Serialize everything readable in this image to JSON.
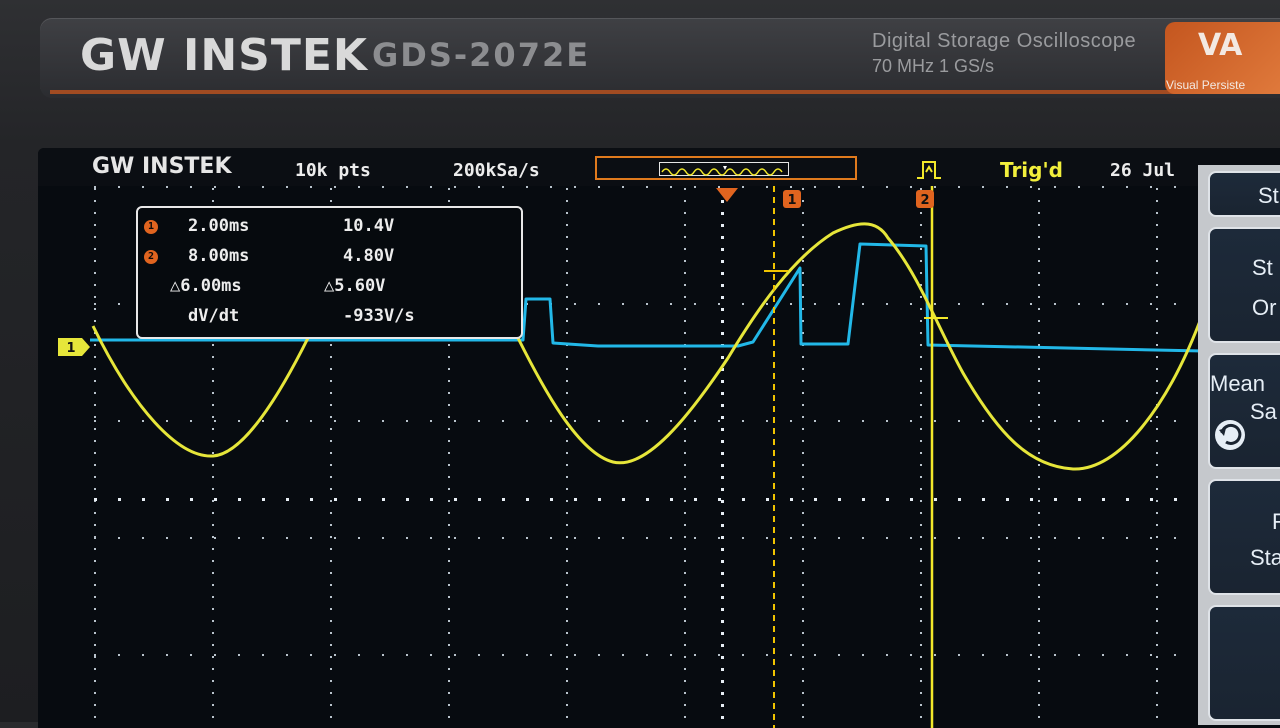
{
  "brand": {
    "logo": "GW INSTEK",
    "model": "GDS-2072E",
    "description_line1": "Digital  Storage  Oscilloscope",
    "description_line2": "70 MHz   1 GS/s",
    "va_logo": "VA",
    "va_subtitle": "Visual Persiste"
  },
  "status_bar": {
    "logo": "GW INSTEK",
    "record_length": "10k pts",
    "sample_rate": "200kSa/s",
    "trigger_status": "Trig'd",
    "date": "26 Jul"
  },
  "markers": {
    "channel1": "1",
    "cursor1": "1",
    "cursor2": "2"
  },
  "cursor_readout": {
    "cursor1": {
      "badge": "1",
      "time": "2.00ms",
      "voltage": "10.4V"
    },
    "cursor2": {
      "badge": "2",
      "time": "8.00ms",
      "voltage": "4.80V"
    },
    "delta": {
      "time": "△6.00ms",
      "voltage": "△5.60V"
    },
    "slope": {
      "label": "dV/dt",
      "value": "-933V/s"
    }
  },
  "side_menu": {
    "key1": "St",
    "key2_line1": "St",
    "key2_line2": "Or",
    "key3_line1": "Mean",
    "key3_line2": "Sa",
    "key4_line1": "F",
    "key4_line2": "Sta",
    "key5": ""
  },
  "colors": {
    "channel1_trace": "#e6e63a",
    "channel2_trace": "#22b8e8",
    "cursor1": "#f0c400",
    "cursor2": "#f2e82a",
    "accent_orange": "#e0641f"
  },
  "icons": {
    "trigger": "rising-edge-trigger-icon",
    "rotary": "rotary-knob-icon"
  }
}
